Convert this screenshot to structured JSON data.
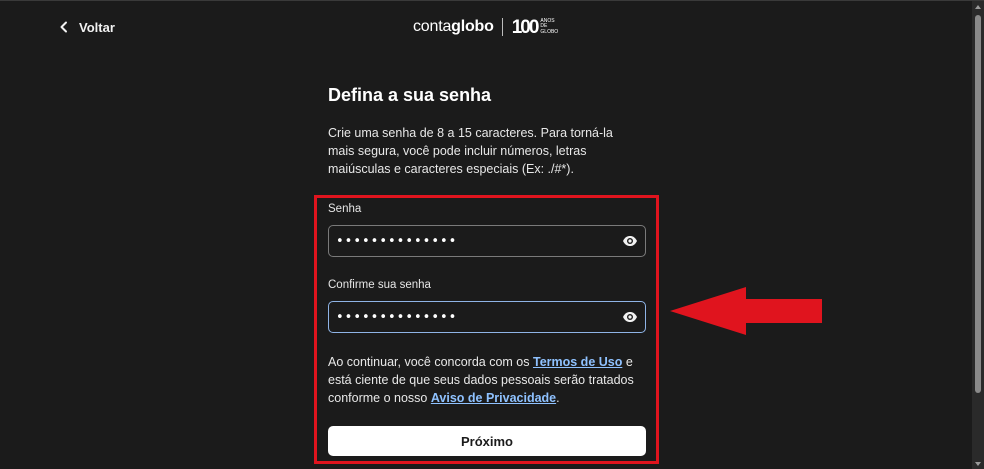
{
  "header": {
    "back_label": "Voltar",
    "logo": {
      "brand_light": "conta",
      "brand_bold": "globo",
      "number": "100",
      "tagline_lines": [
        "ANOS",
        "DE",
        "GLOBO"
      ]
    }
  },
  "main": {
    "title": "Defina a sua senha",
    "description": "Crie uma senha de 8 a 15 caracteres. Para torná-la mais segura, você pode incluir números, letras maiúsculas e caracteres especiais (Ex: ./#*).",
    "password_field": {
      "label": "Senha",
      "value": "••••••••••••••",
      "icon": "eye-icon"
    },
    "confirm_field": {
      "label": "Confirme sua senha",
      "value": "••••••••••••••",
      "icon": "eye-icon"
    },
    "terms": {
      "prefix": "Ao continuar, você concorda com os ",
      "terms_link": "Termos de Uso",
      "middle": " e está ciente de que seus dados pessoais serão tratados conforme o nosso ",
      "privacy_link": "Aviso de Privacidade",
      "suffix": "."
    },
    "next_button": "Próximo"
  },
  "annotations": {
    "highlight_color": "#e0141e",
    "arrow_color": "#e0141e",
    "arrow_icon": "arrow-left-icon"
  },
  "colors": {
    "background": "#1b1b1b",
    "link": "#8fc2ff",
    "focus_border": "#8fb4e6"
  }
}
